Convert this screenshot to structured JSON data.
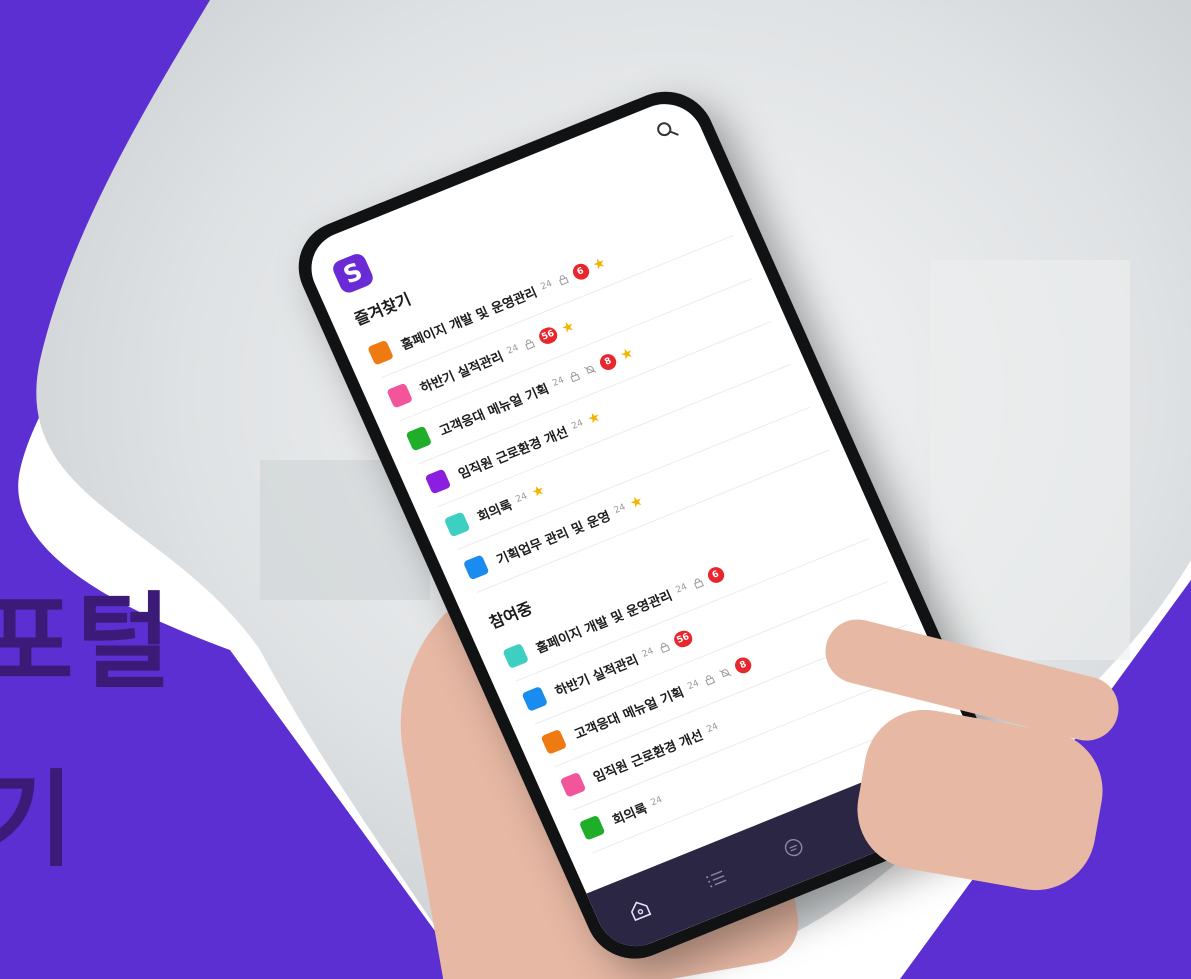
{
  "hero": {
    "line1": "포털",
    "line2": "기"
  },
  "colors": {
    "brand_purple": "#5b2fd1",
    "headline": "#3b1a78",
    "badge_red": "#e8262d",
    "star_yellow": "#f4b400",
    "nav_bg": "#2b2644"
  },
  "app": {
    "logo_letter": "S",
    "search_icon": "search-icon",
    "favorites": {
      "title": "즐겨찾기",
      "items": [
        {
          "name": "홈페이지 개발 및 운영관리",
          "meta": "24",
          "color": "#f07a12",
          "lock": true,
          "mute": false,
          "badge": "6",
          "starred": true
        },
        {
          "name": "하반기 실적관리",
          "meta": "24",
          "color": "#f2559a",
          "lock": true,
          "mute": false,
          "badge": "56",
          "starred": true
        },
        {
          "name": "고객응대 메뉴얼 기획",
          "meta": "24",
          "color": "#1fae2a",
          "lock": true,
          "mute": true,
          "badge": "8",
          "starred": true
        },
        {
          "name": "임직원 근로환경 개선",
          "meta": "24",
          "color": "#8a1fe0",
          "lock": false,
          "mute": false,
          "badge": "",
          "starred": true
        },
        {
          "name": "회의록",
          "meta": "24",
          "color": "#3dcfc2",
          "lock": false,
          "mute": false,
          "badge": "",
          "starred": true
        },
        {
          "name": "기획업무 관리 및 운영",
          "meta": "24",
          "color": "#1a8cf0",
          "lock": false,
          "mute": false,
          "badge": "",
          "starred": true
        }
      ]
    },
    "participating": {
      "title": "참여중",
      "items": [
        {
          "name": "홈페이지 개발 및 운영관리",
          "meta": "24",
          "color": "#3dcfc2",
          "lock": true,
          "mute": false,
          "badge": "6",
          "starred": false
        },
        {
          "name": "하반기 실적관리",
          "meta": "24",
          "color": "#1a8cf0",
          "lock": true,
          "mute": false,
          "badge": "56",
          "starred": false
        },
        {
          "name": "고객응대 메뉴얼 기획",
          "meta": "24",
          "color": "#f07a12",
          "lock": true,
          "mute": true,
          "badge": "8",
          "starred": false
        },
        {
          "name": "임직원 근로환경 개선",
          "meta": "24",
          "color": "#f2559a",
          "lock": false,
          "mute": false,
          "badge": "",
          "starred": false
        },
        {
          "name": "회의록",
          "meta": "24",
          "color": "#1fae2a",
          "lock": false,
          "mute": false,
          "badge": "",
          "starred": false
        }
      ]
    },
    "bottom_nav": [
      {
        "icon": "home-icon"
      },
      {
        "icon": "list-icon"
      },
      {
        "icon": "chat-icon"
      },
      {
        "icon": "bell-icon"
      },
      {
        "icon": "more-icon",
        "text": "···"
      }
    ]
  }
}
